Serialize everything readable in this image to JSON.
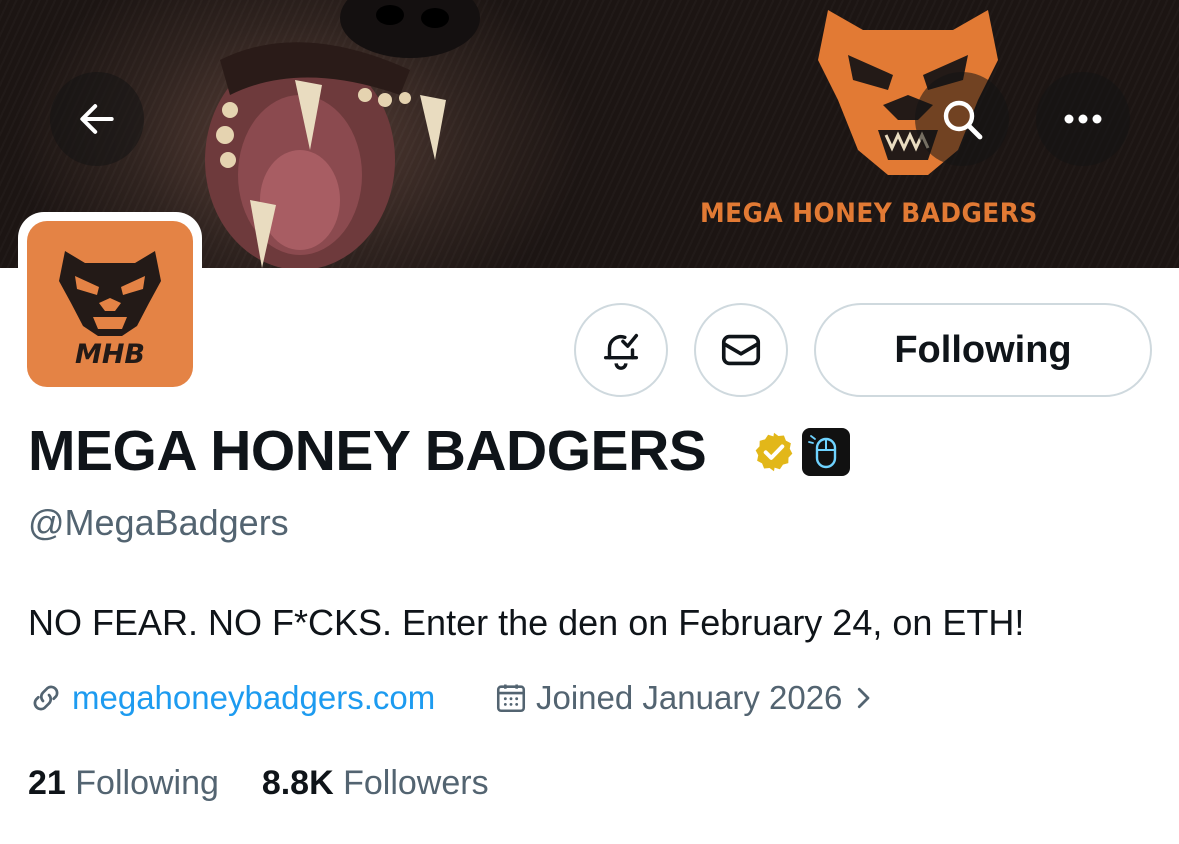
{
  "banner": {
    "brand_title": "MEGA HONEY BADGERS",
    "brand_color": "#e27a34"
  },
  "nav": {
    "back_icon": "arrow-left-icon",
    "search_icon": "search-icon",
    "more_icon": "more-horizontal-icon"
  },
  "avatar": {
    "text": "MHB",
    "background": "#e48345"
  },
  "actions": {
    "notifications_icon": "bell-check-icon",
    "message_icon": "envelope-icon",
    "follow_label": "Following"
  },
  "profile": {
    "display_name": "MEGA HONEY BADGERS",
    "verified_badge": "gold-verified-badge",
    "affiliate_badge": "mouse-icon",
    "handle": "@MegaBadgers",
    "bio": "NO FEAR. NO F*CKS. Enter the den on February 24, on ETH!",
    "website": "megahoneybadgers.com",
    "joined": "Joined January 2026"
  },
  "stats": {
    "following_count": "21",
    "following_label": "Following",
    "followers_count": "8.8K",
    "followers_label": "Followers"
  },
  "colors": {
    "link": "#1d9bf0",
    "secondary_text": "#536471",
    "primary_text": "#0f1419"
  }
}
